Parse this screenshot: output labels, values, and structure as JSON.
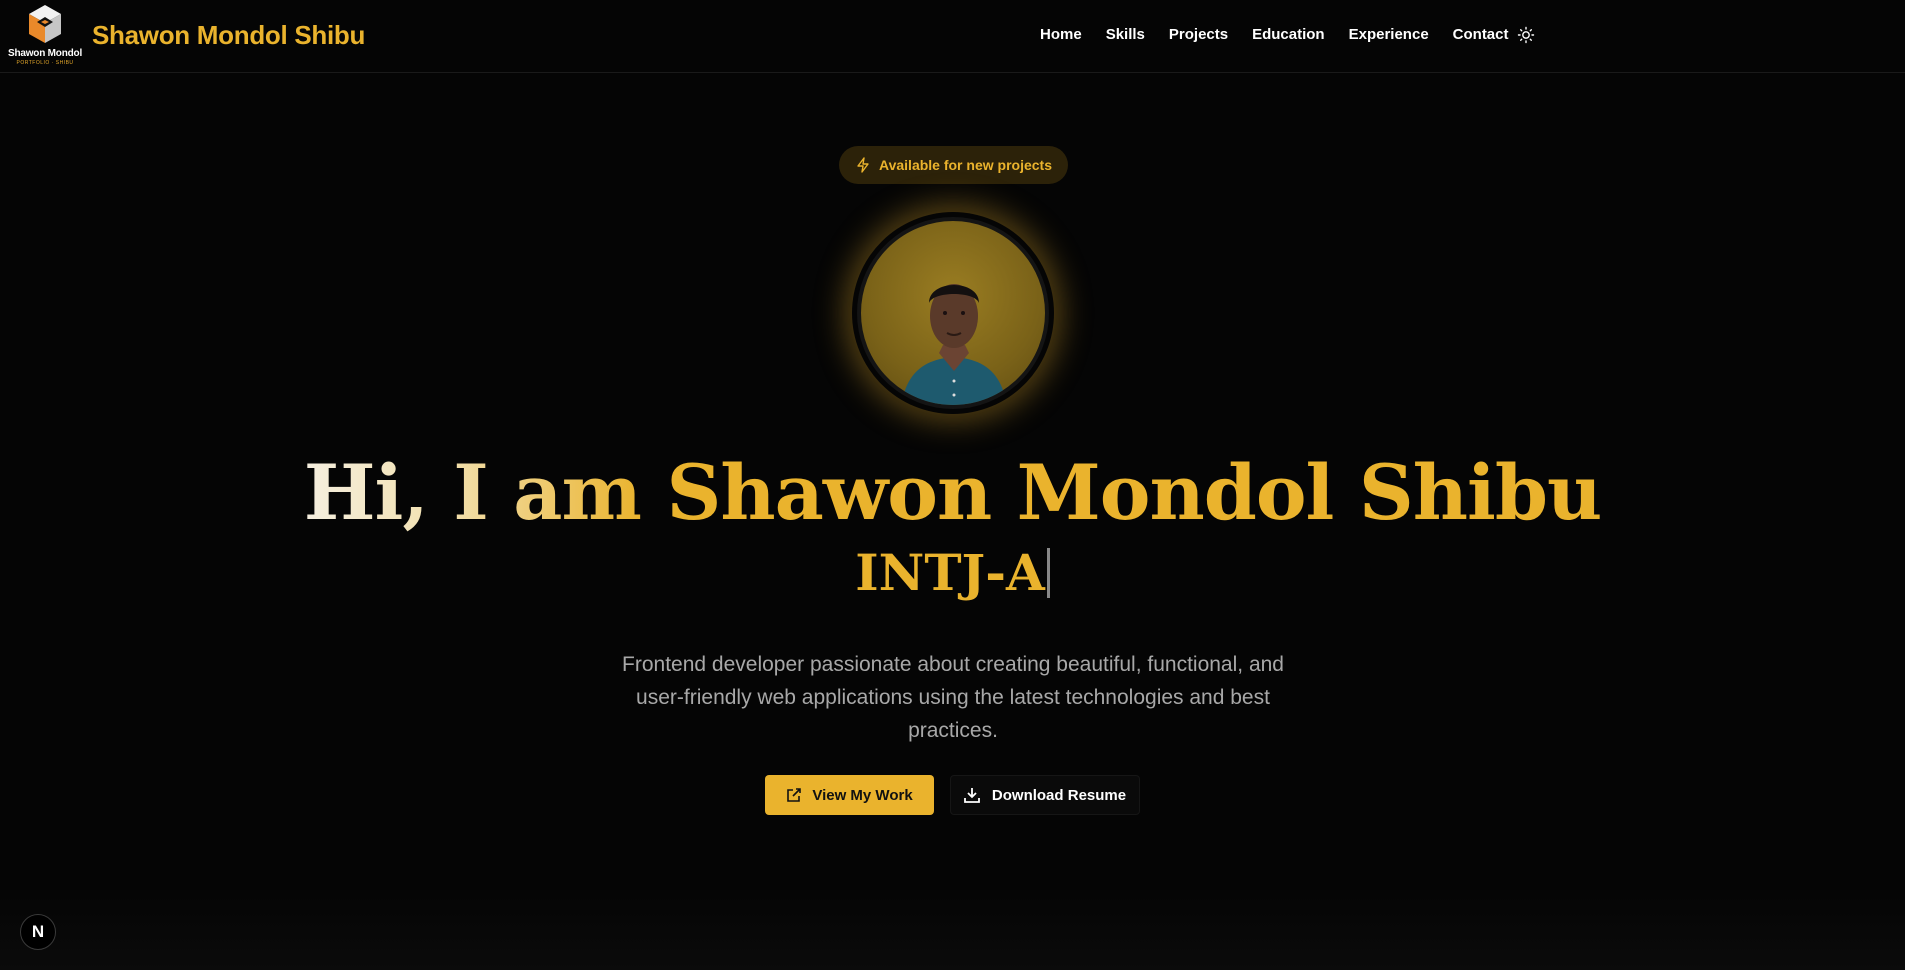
{
  "nav": {
    "logo_name": "Shawon Mondol",
    "logo_sub": "PORTFOLIO · SHIBU",
    "brand": "Shawon Mondol Shibu",
    "links": [
      "Home",
      "Skills",
      "Projects",
      "Education",
      "Experience",
      "Contact"
    ],
    "theme_icon": "sun-icon"
  },
  "hero": {
    "badge": "Available for new projects",
    "badge_icon": "lightning-icon",
    "greeting": "Hi, I am",
    "name": "Shawon Mondol Shibu",
    "typed": "INTJ-A",
    "description": "Frontend developer passionate about creating beautiful, functional, and user-friendly web applications using the latest technologies and best practices.",
    "primary_button": "View My Work",
    "primary_icon": "external-link-icon",
    "secondary_button": "Download Resume",
    "secondary_icon": "download-icon"
  },
  "dev_badge": "N",
  "colors": {
    "accent": "#eab32d",
    "background": "#050505",
    "text_muted": "#a8a8a8"
  }
}
